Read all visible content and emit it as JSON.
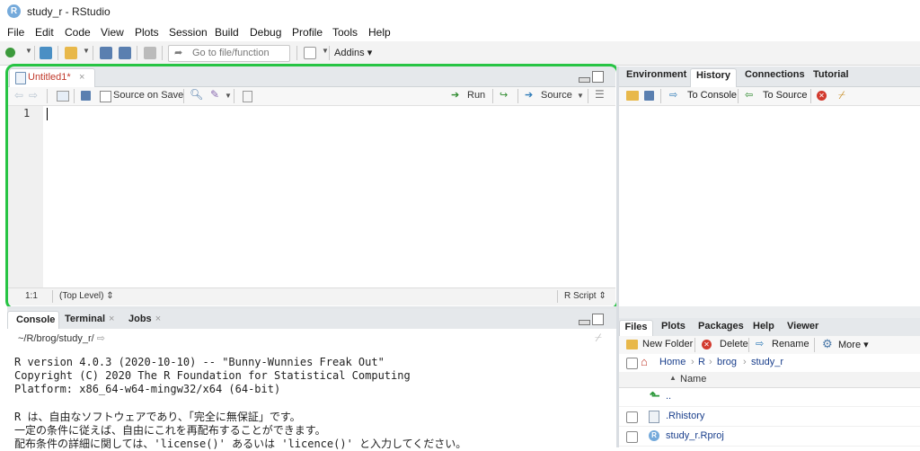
{
  "window": {
    "title": "study_r - RStudio",
    "icon_letter": "R"
  },
  "menu": [
    "File",
    "Edit",
    "Code",
    "View",
    "Plots",
    "Session",
    "Build",
    "Debug",
    "Profile",
    "Tools",
    "Help"
  ],
  "toolbar": {
    "goto_placeholder": "Go to file/function",
    "addins_label": "Addins"
  },
  "source": {
    "tab_label": "Untitled1*",
    "source_on_save_label": "Source on Save",
    "run_label": "Run",
    "source_label": "Source",
    "line_number": "1",
    "status_pos": "1:1",
    "status_scope": "(Top Level)",
    "status_type": "R Script"
  },
  "console": {
    "tabs": [
      "Console",
      "Terminal",
      "Jobs"
    ],
    "path": "~/R/brog/study_r/",
    "lines": [
      "R version 4.0.3 (2020-10-10) -- \"Bunny-Wunnies Freak Out\"",
      "Copyright (C) 2020 The R Foundation for Statistical Computing",
      "Platform: x86_64-w64-mingw32/x64 (64-bit)",
      "",
      "R は、自由なソフトウェアであり、「完全に無保証」です。",
      "一定の条件に従えば、自由にこれを再配布することができます。",
      "配布条件の詳細に関しては、'license()' あるいは 'licence()' と入力してください。"
    ]
  },
  "env": {
    "tabs": [
      "Environment",
      "History",
      "Connections",
      "Tutorial"
    ],
    "active_tab": "History",
    "to_console_label": "To Console",
    "to_source_label": "To Source"
  },
  "files": {
    "tabs": [
      "Files",
      "Plots",
      "Packages",
      "Help",
      "Viewer"
    ],
    "new_folder_label": "New Folder",
    "delete_label": "Delete",
    "rename_label": "Rename",
    "more_label": "More",
    "breadcrumb": [
      "Home",
      "R",
      "brog",
      "study_r"
    ],
    "name_header": "Name",
    "parent_label": "..",
    "items": [
      ".Rhistory",
      "study_r.Rproj"
    ]
  }
}
